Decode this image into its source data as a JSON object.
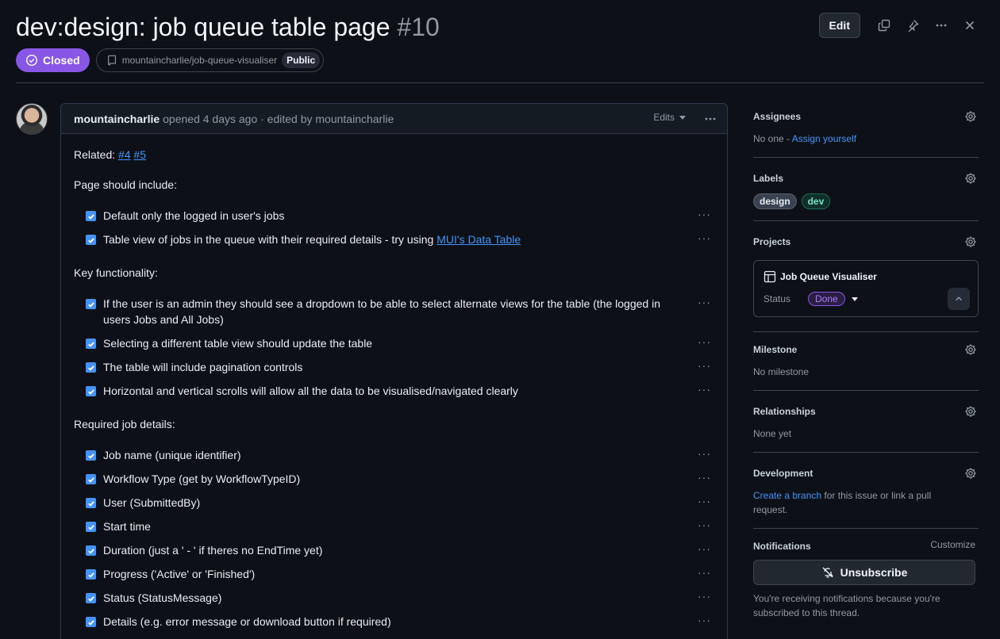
{
  "header": {
    "title": "dev:design: job queue table page",
    "number": "#10",
    "edit_label": "Edit",
    "state": "Closed",
    "repo": "mountaincharlie/job-queue-visualiser",
    "visibility": "Public"
  },
  "comment": {
    "author": "mountaincharlie",
    "meta": "opened 4 days ago · edited by mountaincharlie",
    "edits_label": "Edits",
    "related_prefix": "Related:",
    "related_links": [
      "#4",
      "#5"
    ],
    "sections": [
      {
        "heading": "Page should include:",
        "tasks": [
          "Default only the logged in user's jobs",
          "Table view of jobs in the queue with their required details - try using "
        ]
      },
      {
        "heading": "Key functionality:",
        "tasks": [
          "If the user is an admin they should see a dropdown to be able to select alternate views for the table (the logged in users Jobs and All Jobs)",
          "Selecting a different table view should update the table",
          "The table will include pagination controls",
          "Horizontal and vertical scrolls will allow all the data to be visualised/navigated clearly"
        ]
      },
      {
        "heading": "Required job details:",
        "tasks": [
          "Job name (unique identifier)",
          "Workflow Type (get by WorkflowTypeID)",
          "User (SubmittedBy)",
          "Start time",
          "Duration (just a ' - ' if theres no EndTime yet)",
          "Progress ('Active' or 'Finished')",
          "Status (StatusMessage)",
          "Details (e.g. error message or download button if required)"
        ]
      }
    ],
    "mui_link": "MUI's Data Table",
    "more_glyph": "···"
  },
  "sidebar": {
    "assignees": {
      "title": "Assignees",
      "text": "No one - ",
      "link": "Assign yourself"
    },
    "labels": {
      "title": "Labels",
      "items": [
        {
          "name": "design",
          "color": "#3a4150",
          "text_color": "#e6edf3"
        },
        {
          "name": "dev",
          "color": "#0f2f2a",
          "text_color": "#7ee2c4"
        }
      ]
    },
    "projects": {
      "title": "Projects",
      "project_name": "Job Queue Visualiser",
      "status_label": "Status",
      "status_value": "Done"
    },
    "milestone": {
      "title": "Milestone",
      "text": "No milestone"
    },
    "relationships": {
      "title": "Relationships",
      "text": "None yet"
    },
    "development": {
      "title": "Development",
      "link": "Create a branch",
      "text": " for this issue or link a pull request."
    },
    "notifications": {
      "title": "Notifications",
      "customize": "Customize",
      "button": "Unsubscribe",
      "text": "You're receiving notifications because you're subscribed to this thread."
    }
  },
  "colors": {
    "closed": "#8957e5",
    "link": "#4493f8",
    "bg": "#0d1117"
  }
}
